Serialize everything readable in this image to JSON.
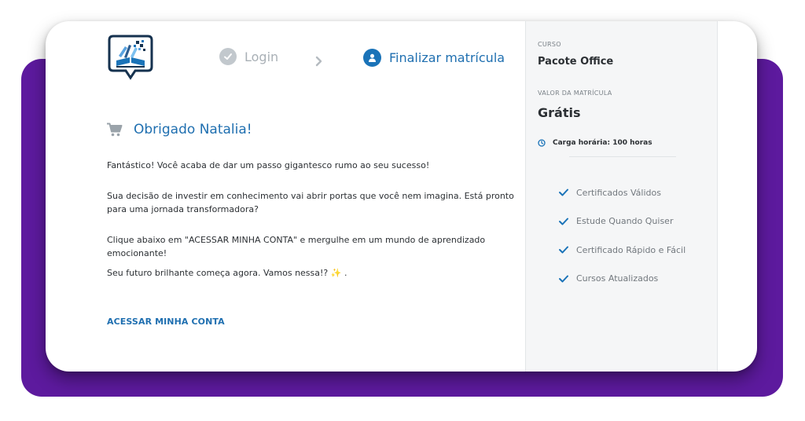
{
  "steps": {
    "login_label": "Login",
    "final_label": "Finalizar matrícula"
  },
  "main": {
    "title": "Obrigado Natalia!",
    "paragraphs": [
      "Fantástico! Você acaba de dar um passo gigantesco rumo ao seu sucesso!",
      "Sua decisão de investir em conhecimento vai abrir portas que você nem imagina. Está pronto para uma jornada transformadora?",
      "Clique abaixo em \"ACESSAR MINHA CONTA\" e mergulhe em um mundo de aprendizado emocionante!",
      "Seu futuro brilhante começa agora. Vamos nessa!?"
    ],
    "p4_suffix": ".",
    "cta_label": "ACESSAR MINHA CONTA"
  },
  "sidebar": {
    "course_label": "CURSO",
    "course_name": "Pacote Office",
    "price_label": "VALOR DA MATRÍCULA",
    "price": "Grátis",
    "hours": "Carga horária: 100 horas",
    "benefits": [
      "Certificados Válidos",
      "Estude Quando Quiser",
      "Certificado Rápido e Fácil",
      "Cursos Atualizados"
    ]
  },
  "colors": {
    "accent": "#1f6fb0",
    "backdrop": "#5d1a9e",
    "muted": "#a9b0b6"
  },
  "icons": {
    "logo": "chat-bubble-books-logo",
    "step_done": "check-circle-icon",
    "step_current": "user-circle-icon",
    "separator": "chevron-right-icon",
    "cart": "shopping-cart-icon",
    "clock": "clock-icon",
    "benefit": "check-icon",
    "sparkle": "sparkles-emoji"
  }
}
